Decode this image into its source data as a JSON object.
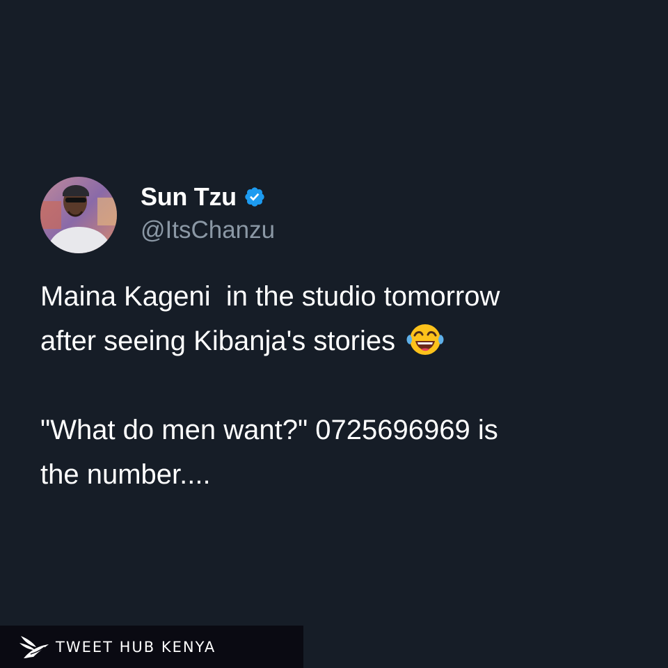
{
  "tweet": {
    "author": {
      "display_name": "Sun Tzu",
      "handle": "@ItsChanzu",
      "verified": true,
      "verified_icon": "verified-badge-icon"
    },
    "text_line_1": "Maina Kageni  in the studio tomorrow",
    "text_line_2": "after seeing Kibanja's stories",
    "text_emoji": "face-with-tears-of-joy-icon",
    "text_line_3": "\"What do men want?\" 0725696969 is",
    "text_line_4": "the number...."
  },
  "watermark": {
    "text": "TWEET HUB KENYA",
    "logo_icon": "bird-logo-icon"
  },
  "colors": {
    "background": "#161d27",
    "text": "#ffffff",
    "handle": "#8b98a5",
    "verified": "#1d9bf0",
    "watermark_bg": "#0a0a12"
  }
}
